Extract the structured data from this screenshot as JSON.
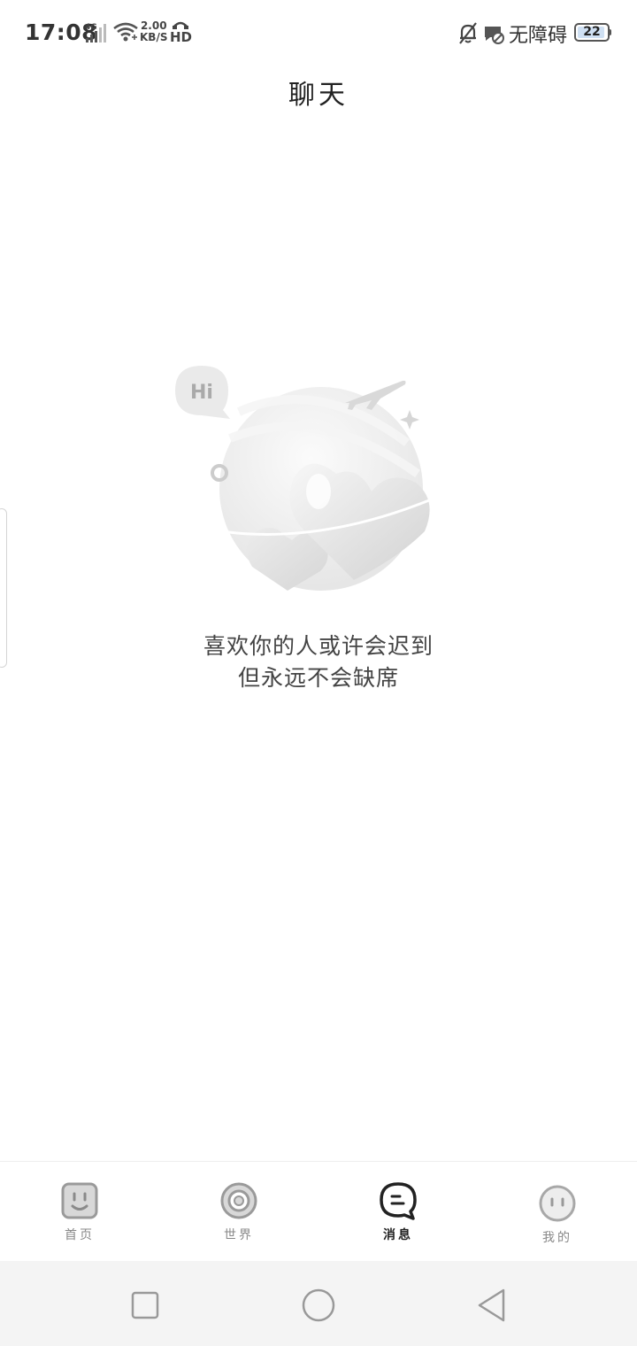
{
  "status_bar": {
    "time": "17:08",
    "network_type": "4G",
    "speed_value": "2.00",
    "speed_unit": "KB/S",
    "hd_label": "HD",
    "accessibility_label": "无障碍",
    "battery_level": "22"
  },
  "header": {
    "title": "聊天"
  },
  "empty_state": {
    "bubble_text": "Hi",
    "line1": "喜欢你的人或许会迟到",
    "line2": "但永远不会缺席"
  },
  "bottom_nav": {
    "items": [
      {
        "label": "首页",
        "icon": "home-face-icon",
        "active": false
      },
      {
        "label": "世界",
        "icon": "world-circle-icon",
        "active": false
      },
      {
        "label": "消息",
        "icon": "message-bubble-icon",
        "active": true
      },
      {
        "label": "我的",
        "icon": "profile-face-icon",
        "active": false
      }
    ]
  },
  "system_nav": {
    "buttons": [
      "recent-apps",
      "home",
      "back"
    ]
  },
  "colors": {
    "background": "#ffffff",
    "active_nav": "#222222",
    "inactive_nav": "#888888",
    "system_nav_bg": "#f4f4f4"
  }
}
